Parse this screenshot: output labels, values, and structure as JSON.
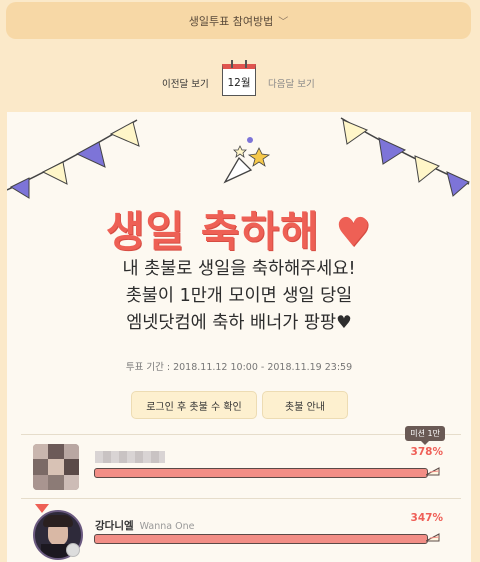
{
  "header": {
    "howto_label": "생일투표 참여방법",
    "chevron_icon": "chevron-down-icon"
  },
  "month_nav": {
    "prev_label": "이전달 보기",
    "month_label": "12월",
    "next_label": "다음달 보기"
  },
  "banner": {
    "title": "생일 축하해",
    "heart": "♥",
    "lines": [
      "내 촛불로 생일을 축하해주세요!",
      "촛불이 1만개 모이면 생일 당일",
      "엠넷닷컴에 축하 배너가 팡팡♥"
    ],
    "period": "투표 기간 : 2018.11.12 10:00 - 2018.11.19 23:59",
    "login_button": "로그인 후 촛불 수 확인",
    "guide_button": "촛불 안내"
  },
  "ranking": [
    {
      "name": "",
      "group": "",
      "percent": "378%",
      "progress": 1.0,
      "mission_badge": "미션 1만",
      "obscured": true
    },
    {
      "name": "강다니엘",
      "group": "Wanna One",
      "percent": "347%",
      "progress": 1.0,
      "mission_badge": "",
      "obscured": false
    }
  ],
  "colors": {
    "page_bg": "#fbe9c9",
    "accent": "#ee6055",
    "bar_fill": "#f28e86"
  }
}
